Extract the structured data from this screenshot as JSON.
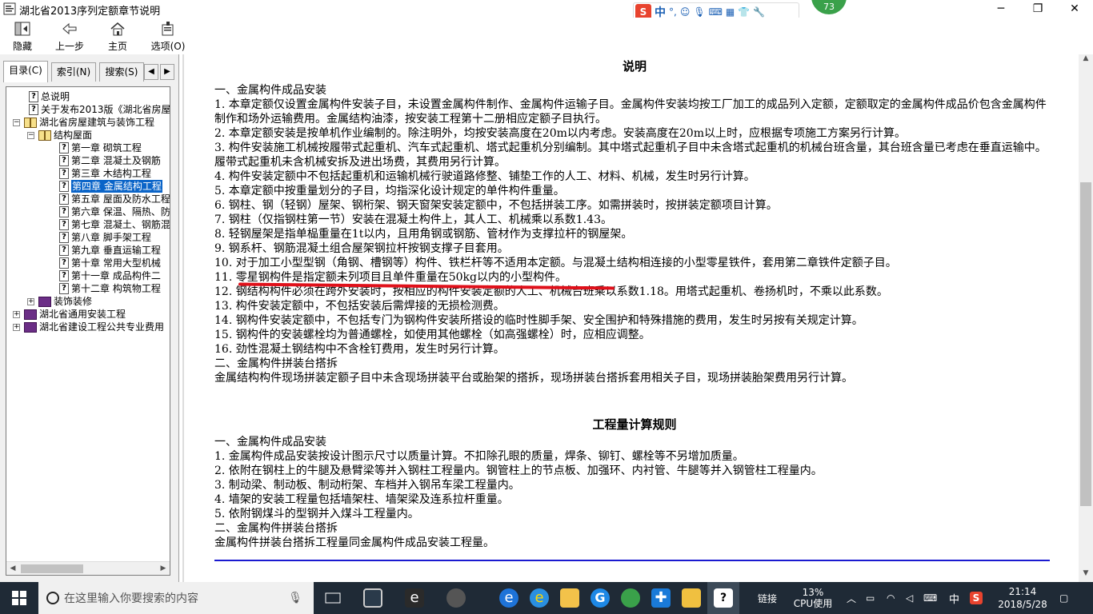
{
  "window": {
    "title": "湖北省2013序列定额章节说明",
    "minimize": "─",
    "maximize": "❐",
    "close": "✕"
  },
  "ime": {
    "mode": "中",
    "punct": "°,",
    "badge": "73"
  },
  "toolbar": {
    "hide": "隐藏",
    "back": "上一步",
    "home": "主页",
    "options": "选项(O)"
  },
  "left_tabs": {
    "contents": "目录(C)",
    "index": "索引(N)",
    "search": "搜索(S)"
  },
  "tree": {
    "items": [
      "总说明",
      "关于发布2013版《湖北省房屋",
      "湖北省房屋建筑与装饰工程",
      "结构屋面",
      "第一章 砌筑工程",
      "第二章 混凝土及钢筋",
      "第三章 木结构工程",
      "第四章 金属结构工程",
      "第五章 屋面及防水工程",
      "第六章 保温、隔热、防",
      "第七章 混凝土、钢筋混",
      "第八章 脚手架工程",
      "第九章 垂直运输工程",
      "第十章 常用大型机械",
      "第十一章 成品构件二",
      "第十二章 构筑物工程",
      "装饰装修",
      "湖北省通用安装工程",
      "湖北省建设工程公共专业费用"
    ]
  },
  "doc": {
    "heading1": "说明",
    "s1_title": "一、金属构件成品安装",
    "s1_lines": [
      "1. 本章定额仅设置金属构件安装子目，未设置金属构件制作、金属构件运输子目。金属构件安装均按工厂加工的成品列入定额，定额取定的金属构件成品价包含金属构件制作和场外运输费用。金属结构油漆，按安装工程第十二册相应定额子目执行。",
      "2. 本章定额安装是按单机作业编制的。除注明外，均按安装高度在20m以内考虑。安装高度在20m以上时，应根据专项施工方案另行计算。",
      "3. 构件安装施工机械按履带式起重机、汽车式起重机、塔式起重机分别编制。其中塔式起重机子目中未含塔式起重机的机械台班含量，其台班含量已考虑在垂直运输中。履带式起重机未含机械安拆及进出场费，其费用另行计算。",
      "4. 构件安装定额中不包括起重机和运输机械行驶道路修整、铺垫工作的人工、材料、机械，发生时另行计算。",
      "5. 本章定额中按重量划分的子目，均指深化设计规定的单件构件重量。",
      "6. 钢柱、钢（轻钢）屋架、钢桁架、钢天窗架安装定额中，不包括拼装工序。如需拼装时，按拼装定额项目计算。",
      "7. 钢柱（仅指钢柱第一节）安装在混凝土构件上，其人工、机械乘以系数1.43。",
      "8. 轻钢屋架是指单榀重量在1t以内，且用角钢或钢筋、管材作为支撑拉杆的钢屋架。",
      "9. 钢系杆、钢筋混凝土组合屋架钢拉杆按钢支撑子目套用。",
      "10. 对于加工小型型钢（角钢、槽钢等）构件、铁栏杆等不适用本定额。与混凝土结构相连接的小型零星铁件，套用第二章铁件定额子目。",
      "11. 零星钢构件是指定额未列项目且单件重量在50kg以内的小型构件。",
      "12. 钢结构构件必须在跨外安装时，按相应的构件安装定额的人工、机械台班乘以系数1.18。用塔式起重机、卷扬机时，不乘以此系数。",
      "13. 构件安装定额中，不包括安装后需焊接的无损检测费。",
      "14. 钢构件安装定额中，不包括专门为钢构件安装所搭设的临时性脚手架、安全围护和特殊措施的费用，发生时另按有关规定计算。",
      "15. 钢构件的安装螺栓均为普通螺栓，如使用其他螺栓（如高强螺栓）时，应相应调整。",
      "16. 劲性混凝土钢结构中不含栓钉费用，发生时另行计算。"
    ],
    "s2_title": "二、金属构件拼装台搭拆",
    "s2_text": "金属结构构件现场拼装定额子目中未含现场拼装平台或胎架的搭拆，现场拼装台搭拆套用相关子目，现场拼装胎架费用另行计算。",
    "heading2": "工程量计算规则",
    "r1_title": "一、金属构件成品安装",
    "r1_lines": [
      "1. 金属构件成品安装按设计图示尺寸以质量计算。不扣除孔眼的质量，焊条、铆钉、螺栓等不另增加质量。",
      "2. 依附在钢柱上的牛腿及悬臂梁等并入钢柱工程量内。钢管柱上的节点板、加强环、内衬管、牛腿等并入钢管柱工程量内。",
      "3. 制动梁、制动板、制动桁架、车档并入钢吊车梁工程量内。",
      "4. 墙架的安装工程量包括墙架柱、墙架梁及连系拉杆重量。",
      "5. 依附钢煤斗的型钢并入煤斗工程量内。"
    ],
    "r2_title": "二、金属构件拼装台搭拆",
    "r2_text": "金属构件拼装台搭拆工程量同金属构件成品安装工程量。"
  },
  "taskbar": {
    "search_placeholder": "在这里输入你要搜索的内容",
    "links": "链接",
    "cpu_pct": "13%",
    "cpu_label": "CPU使用",
    "lang": "中",
    "time": "21:14",
    "date": "2018/5/28"
  },
  "colors": {
    "accent": "#0a64c8",
    "underline": "#e0101a",
    "rule": "#1a1ad0"
  }
}
